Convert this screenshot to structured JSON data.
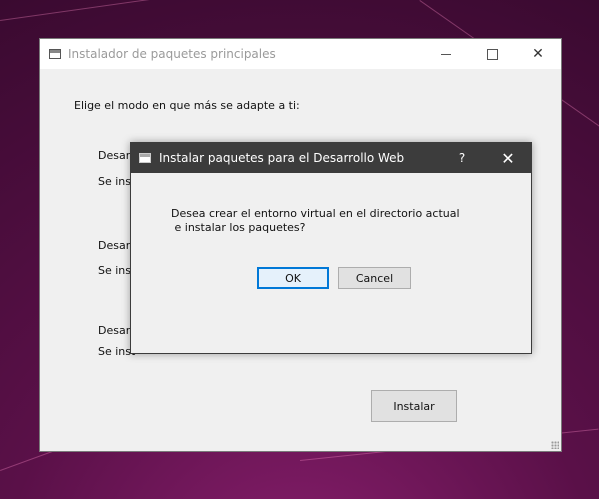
{
  "main_window": {
    "title": "Instalador de paquetes principales",
    "prompt": "Elige el modo en que más se adapte a ti:",
    "option1_title": "Desarr",
    "option1_desc": "Se insta",
    "option2_title": "Desarr",
    "option2_desc": "Se inst",
    "option3_title": "Desarr",
    "option3_desc": "Se inst",
    "install_button": "Instalar",
    "close_glyph": "✕"
  },
  "dialog": {
    "title": "Instalar paquetes para el Desarrollo Web",
    "help_glyph": "?",
    "close_glyph": "✕",
    "message_line1": "Desea crear el entorno virtual en el directorio actual",
    "message_line2": " e instalar los paquetes?",
    "ok_label": "OK",
    "cancel_label": "Cancel"
  }
}
